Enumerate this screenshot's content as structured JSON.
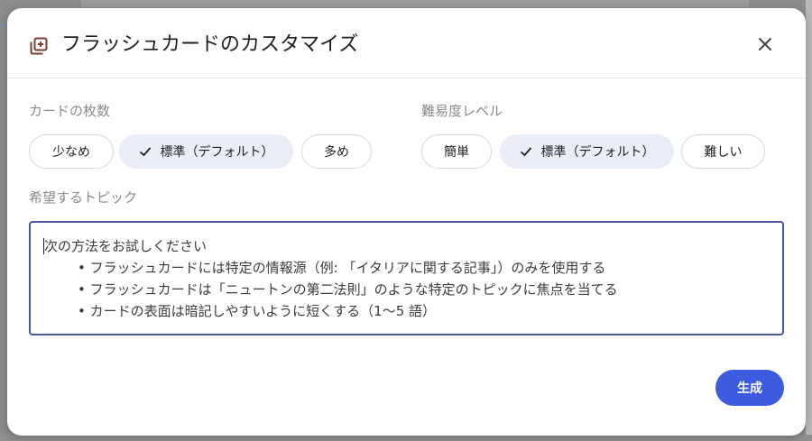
{
  "dialog": {
    "title": "フラッシュカードのカスタマイズ",
    "header_icon": "flashcard-stack-icon",
    "close_icon": "close-icon"
  },
  "card_count": {
    "label": "カードの枚数",
    "options": [
      {
        "label": "少なめ",
        "selected": false
      },
      {
        "label": "標準（デフォルト）",
        "selected": true
      },
      {
        "label": "多め",
        "selected": false
      }
    ]
  },
  "difficulty": {
    "label": "難易度レベル",
    "options": [
      {
        "label": "簡単",
        "selected": false
      },
      {
        "label": "標準（デフォルト）",
        "selected": true
      },
      {
        "label": "難しい",
        "selected": false
      }
    ]
  },
  "topic": {
    "label": "希望するトピック",
    "placeholder_lines": [
      "次の方法をお試しください",
      "• フラッシュカードには特定の情報源（例: 「イタリアに関する記事」）のみを使用する",
      "• フラッシュカードは「ニュートンの第二法則」のような特定のトピックに焦点を当てる",
      "• カードの表面は暗記しやすいように短くする（1〜5 語）"
    ]
  },
  "actions": {
    "generate_label": "生成"
  },
  "colors": {
    "accent": "#3c5be0",
    "selected_chip": "#e8edf8",
    "input_border": "#4a5a98",
    "overlay": "#8a8c8e"
  }
}
